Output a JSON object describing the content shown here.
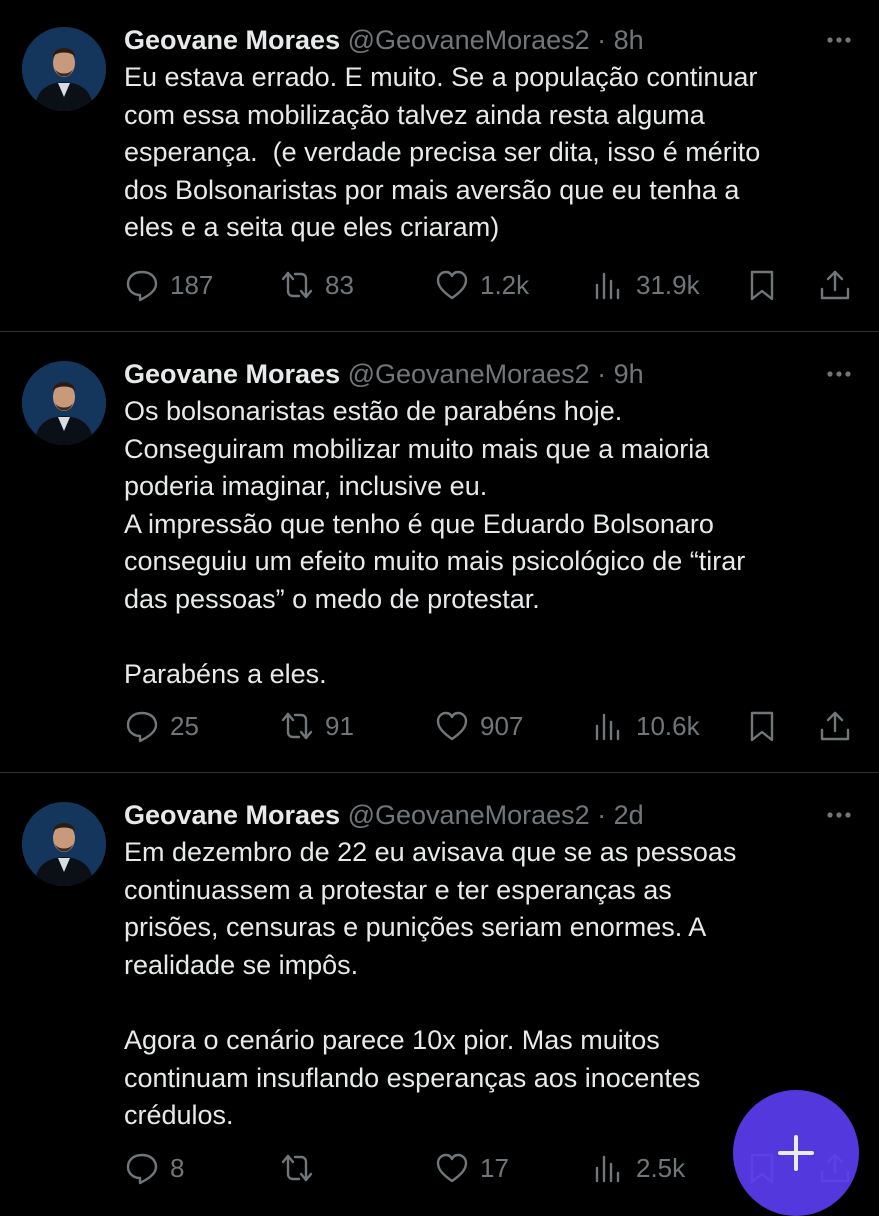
{
  "tweets": [
    {
      "author": "Geovane Moraes",
      "handle": "@GeovaneMoraes2",
      "time": "8h",
      "text": "Eu estava errado. E muito. Se a população continuar\ncom essa mobilização talvez ainda resta alguma\nesperança.  (e verdade precisa ser dita, isso é mérito\ndos Bolsonaristas por mais aversão que eu tenha a\neles e a seita que eles criaram)",
      "replies": "187",
      "retweets": "83",
      "likes": "1.2k",
      "views": "31.9k"
    },
    {
      "author": "Geovane Moraes",
      "handle": "@GeovaneMoraes2",
      "time": "9h",
      "text": "Os bolsonaristas estão de parabéns hoje.\nConseguiram mobilizar muito mais que a maioria\npoderia imaginar, inclusive eu.\nA impressão que tenho é que Eduardo Bolsonaro\nconseguiu um efeito muito mais psicológico de “tirar\ndas pessoas” o medo de protestar.\n\nParabéns a eles.",
      "replies": "25",
      "retweets": "91",
      "likes": "907",
      "views": "10.6k"
    },
    {
      "author": "Geovane Moraes",
      "handle": "@GeovaneMoraes2",
      "time": "2d",
      "text": "Em dezembro de 22 eu avisava que se as pessoas\ncontinuassem a protestar e ter esperanças as\nprisões, censuras e punições seriam enormes. A\nrealidade se impôs.\n\nAgora o cenário parece 10x pior. Mas muitos\ncontinuam insuflando esperanças aos inocentes\ncrédulos.",
      "replies": "8",
      "retweets": "",
      "likes": "17",
      "views": "2.5k"
    }
  ],
  "separator": " · ",
  "fab_icon": "plus-icon",
  "colors": {
    "background": "#000000",
    "text": "#e7e9ea",
    "muted": "#71767b",
    "divider": "#2f3336",
    "fab": "#5b3df0"
  }
}
